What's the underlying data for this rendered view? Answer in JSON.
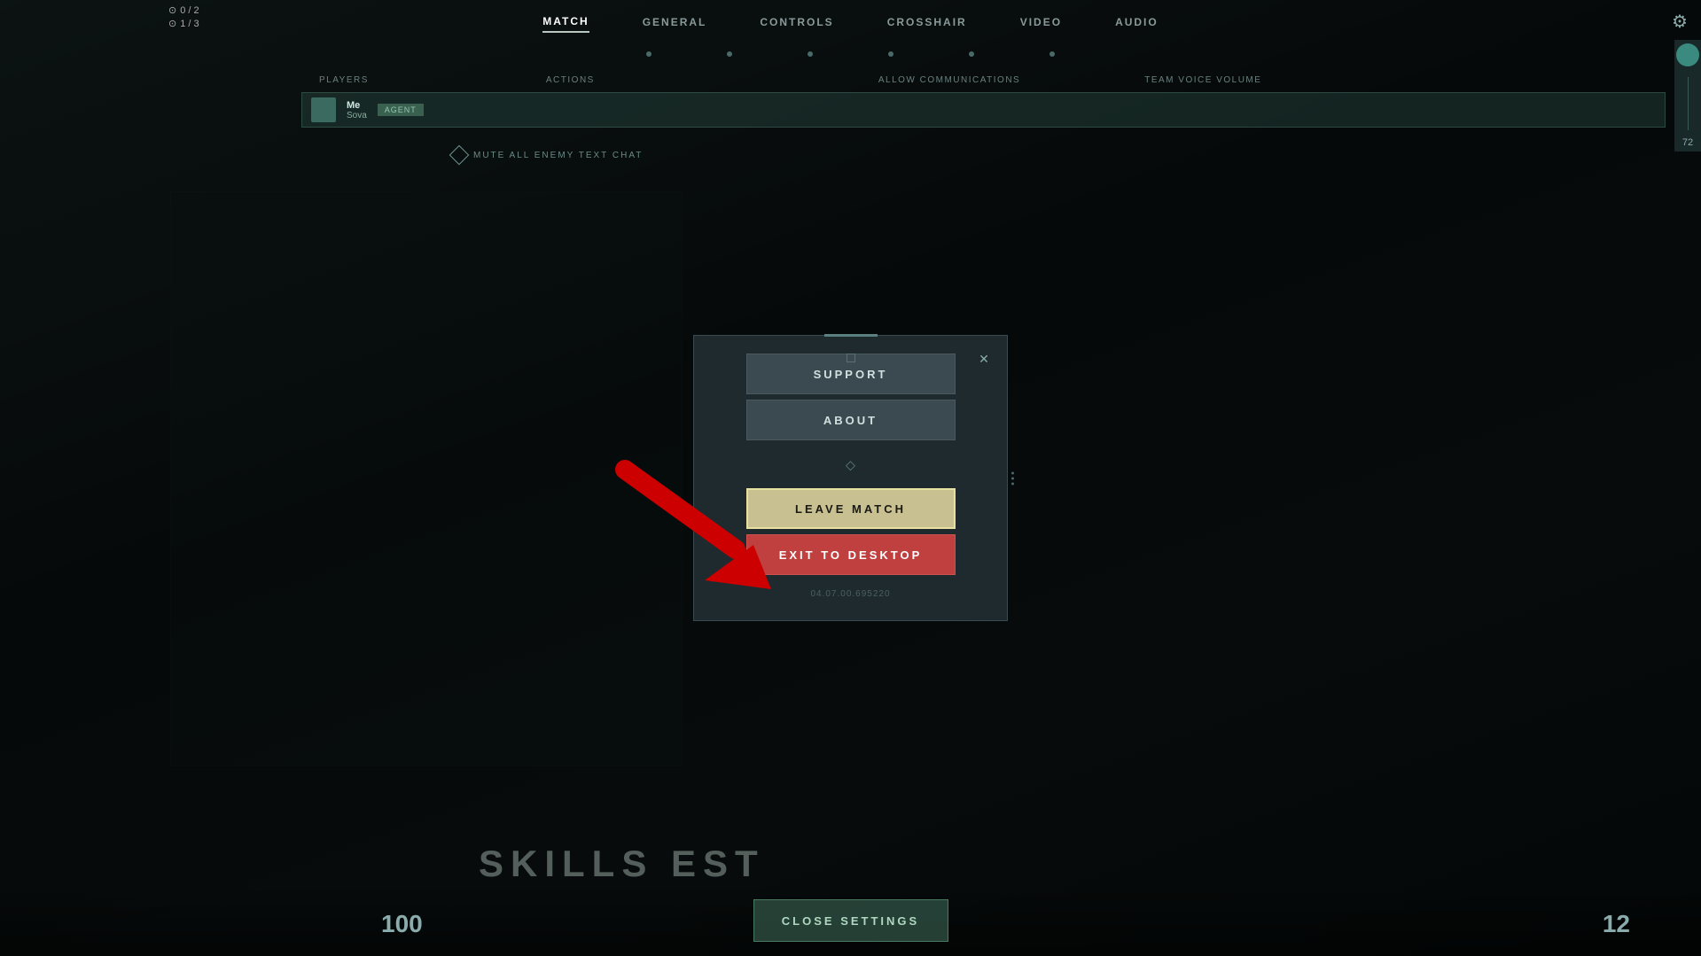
{
  "nav": {
    "tabs": [
      {
        "label": "MATCH",
        "active": true
      },
      {
        "label": "GENERAL",
        "active": false
      },
      {
        "label": "CONTROLS",
        "active": false
      },
      {
        "label": "CROSSHAIR",
        "active": false
      },
      {
        "label": "VIDEO",
        "active": false
      },
      {
        "label": "AUDIO",
        "active": false
      }
    ]
  },
  "score": {
    "row1": "0 / 2",
    "row2": "1 / 3"
  },
  "table": {
    "headers": [
      "PLAYERS",
      "ACTIONS",
      "ALLOW COMMUNICATIONS",
      "TEAM VOICE VOLUME"
    ],
    "player": {
      "name": "Me",
      "agent": "Sova",
      "badge": "AGENT"
    }
  },
  "mute": {
    "label": "MUTE ALL ENEMY TEXT CHAT"
  },
  "modal": {
    "buttons": {
      "support": "SUPPORT",
      "about": "ABOUT",
      "leave_match": "LEAVE MATCH",
      "exit_desktop": "EXIT TO DESKTOP"
    },
    "version": "04.07.00.695220",
    "close_label": "×",
    "divider_icon": "⬦"
  },
  "bottom": {
    "close_settings": "CLOSE SETTINGS",
    "left_number": "100",
    "right_number": "12",
    "skills_text": "SKILLS EST"
  },
  "right_panel": {
    "number": "72"
  }
}
